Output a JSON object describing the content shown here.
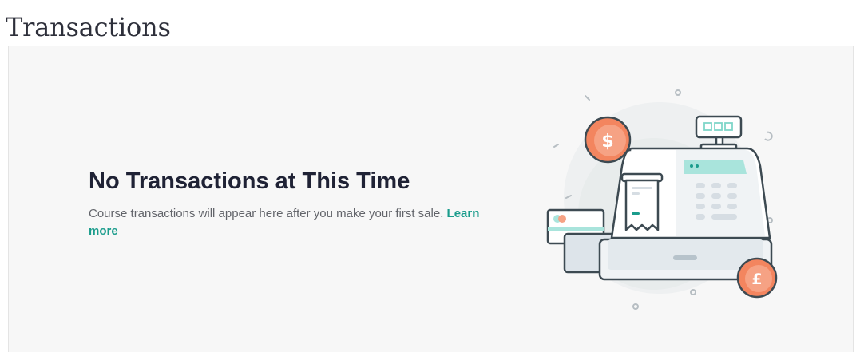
{
  "page": {
    "title": "Transactions"
  },
  "empty_state": {
    "heading": "No Transactions at This Time",
    "description": "Course transactions will appear here after you make your first sale.",
    "link_label": "Learn more",
    "illustration_icon": "cash-register-icon"
  },
  "colors": {
    "accent": "#1a9c8c",
    "coin": "#f3855f",
    "register_body": "#f2f5f7",
    "teal_display": "#a9e4dc",
    "outline": "#3d4a52"
  },
  "illustration": {
    "coin_dollar_symbol": "$",
    "coin_pound_symbol": "£"
  }
}
